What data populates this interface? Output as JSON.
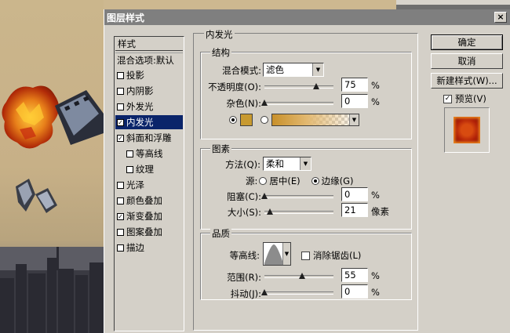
{
  "dialog": {
    "title": "图层样式",
    "close_glyph": "×"
  },
  "styles_list": {
    "header": "样式",
    "items": [
      {
        "label": "混合选项:默认",
        "checkbox": false,
        "checked": false,
        "selected": false
      },
      {
        "label": "投影",
        "checkbox": true,
        "checked": false,
        "selected": false
      },
      {
        "label": "内阴影",
        "checkbox": true,
        "checked": false,
        "selected": false
      },
      {
        "label": "外发光",
        "checkbox": true,
        "checked": false,
        "selected": false
      },
      {
        "label": "内发光",
        "checkbox": true,
        "checked": true,
        "selected": true
      },
      {
        "label": "斜面和浮雕",
        "checkbox": true,
        "checked": true,
        "selected": false
      },
      {
        "label": "等高线",
        "checkbox": true,
        "checked": false,
        "selected": false,
        "indent": true
      },
      {
        "label": "纹理",
        "checkbox": true,
        "checked": false,
        "selected": false,
        "indent": true
      },
      {
        "label": "光泽",
        "checkbox": true,
        "checked": false,
        "selected": false
      },
      {
        "label": "颜色叠加",
        "checkbox": true,
        "checked": false,
        "selected": false
      },
      {
        "label": "渐变叠加",
        "checkbox": true,
        "checked": true,
        "selected": false
      },
      {
        "label": "图案叠加",
        "checkbox": true,
        "checked": false,
        "selected": false
      },
      {
        "label": "描边",
        "checkbox": true,
        "checked": false,
        "selected": false
      }
    ]
  },
  "panel": {
    "title": "内发光",
    "structure": {
      "title": "结构",
      "blend_mode_label": "混合模式:",
      "blend_mode_value": "滤色",
      "opacity_label": "不透明度(O):",
      "opacity_value": "75",
      "noise_label": "杂色(N):",
      "noise_value": "0",
      "percent": "%",
      "color_swatch": "#c89a30",
      "opacity_slider": 75,
      "noise_slider": 0
    },
    "elements": {
      "title": "图素",
      "method_label": "方法(Q):",
      "method_value": "柔和",
      "source_label": "源:",
      "source_center": "居中(E)",
      "source_edge": "边缘(G)",
      "choke_label": "阻塞(C):",
      "choke_value": "0",
      "size_label": "大小(S):",
      "size_value": "21",
      "size_unit": "像素",
      "percent": "%",
      "choke_slider": 0,
      "size_slider": 0.084
    },
    "quality": {
      "title": "品质",
      "contour_label": "等高线:",
      "anti_alias_label": "消除锯齿(L)",
      "range_label": "范围(R):",
      "range_value": "55",
      "jitter_label": "抖动(J):",
      "jitter_value": "0",
      "percent": "%",
      "range_slider": 55,
      "jitter_slider": 0
    }
  },
  "buttons": {
    "ok": "确定",
    "cancel": "取消",
    "new_style": "新建样式(W)...",
    "preview_label": "预览(V)",
    "preview_check": "✓"
  },
  "colors": {
    "selection": "#0a246a",
    "dialog_bg": "#d4d0c8",
    "titlebar": "#7f7f7f"
  }
}
